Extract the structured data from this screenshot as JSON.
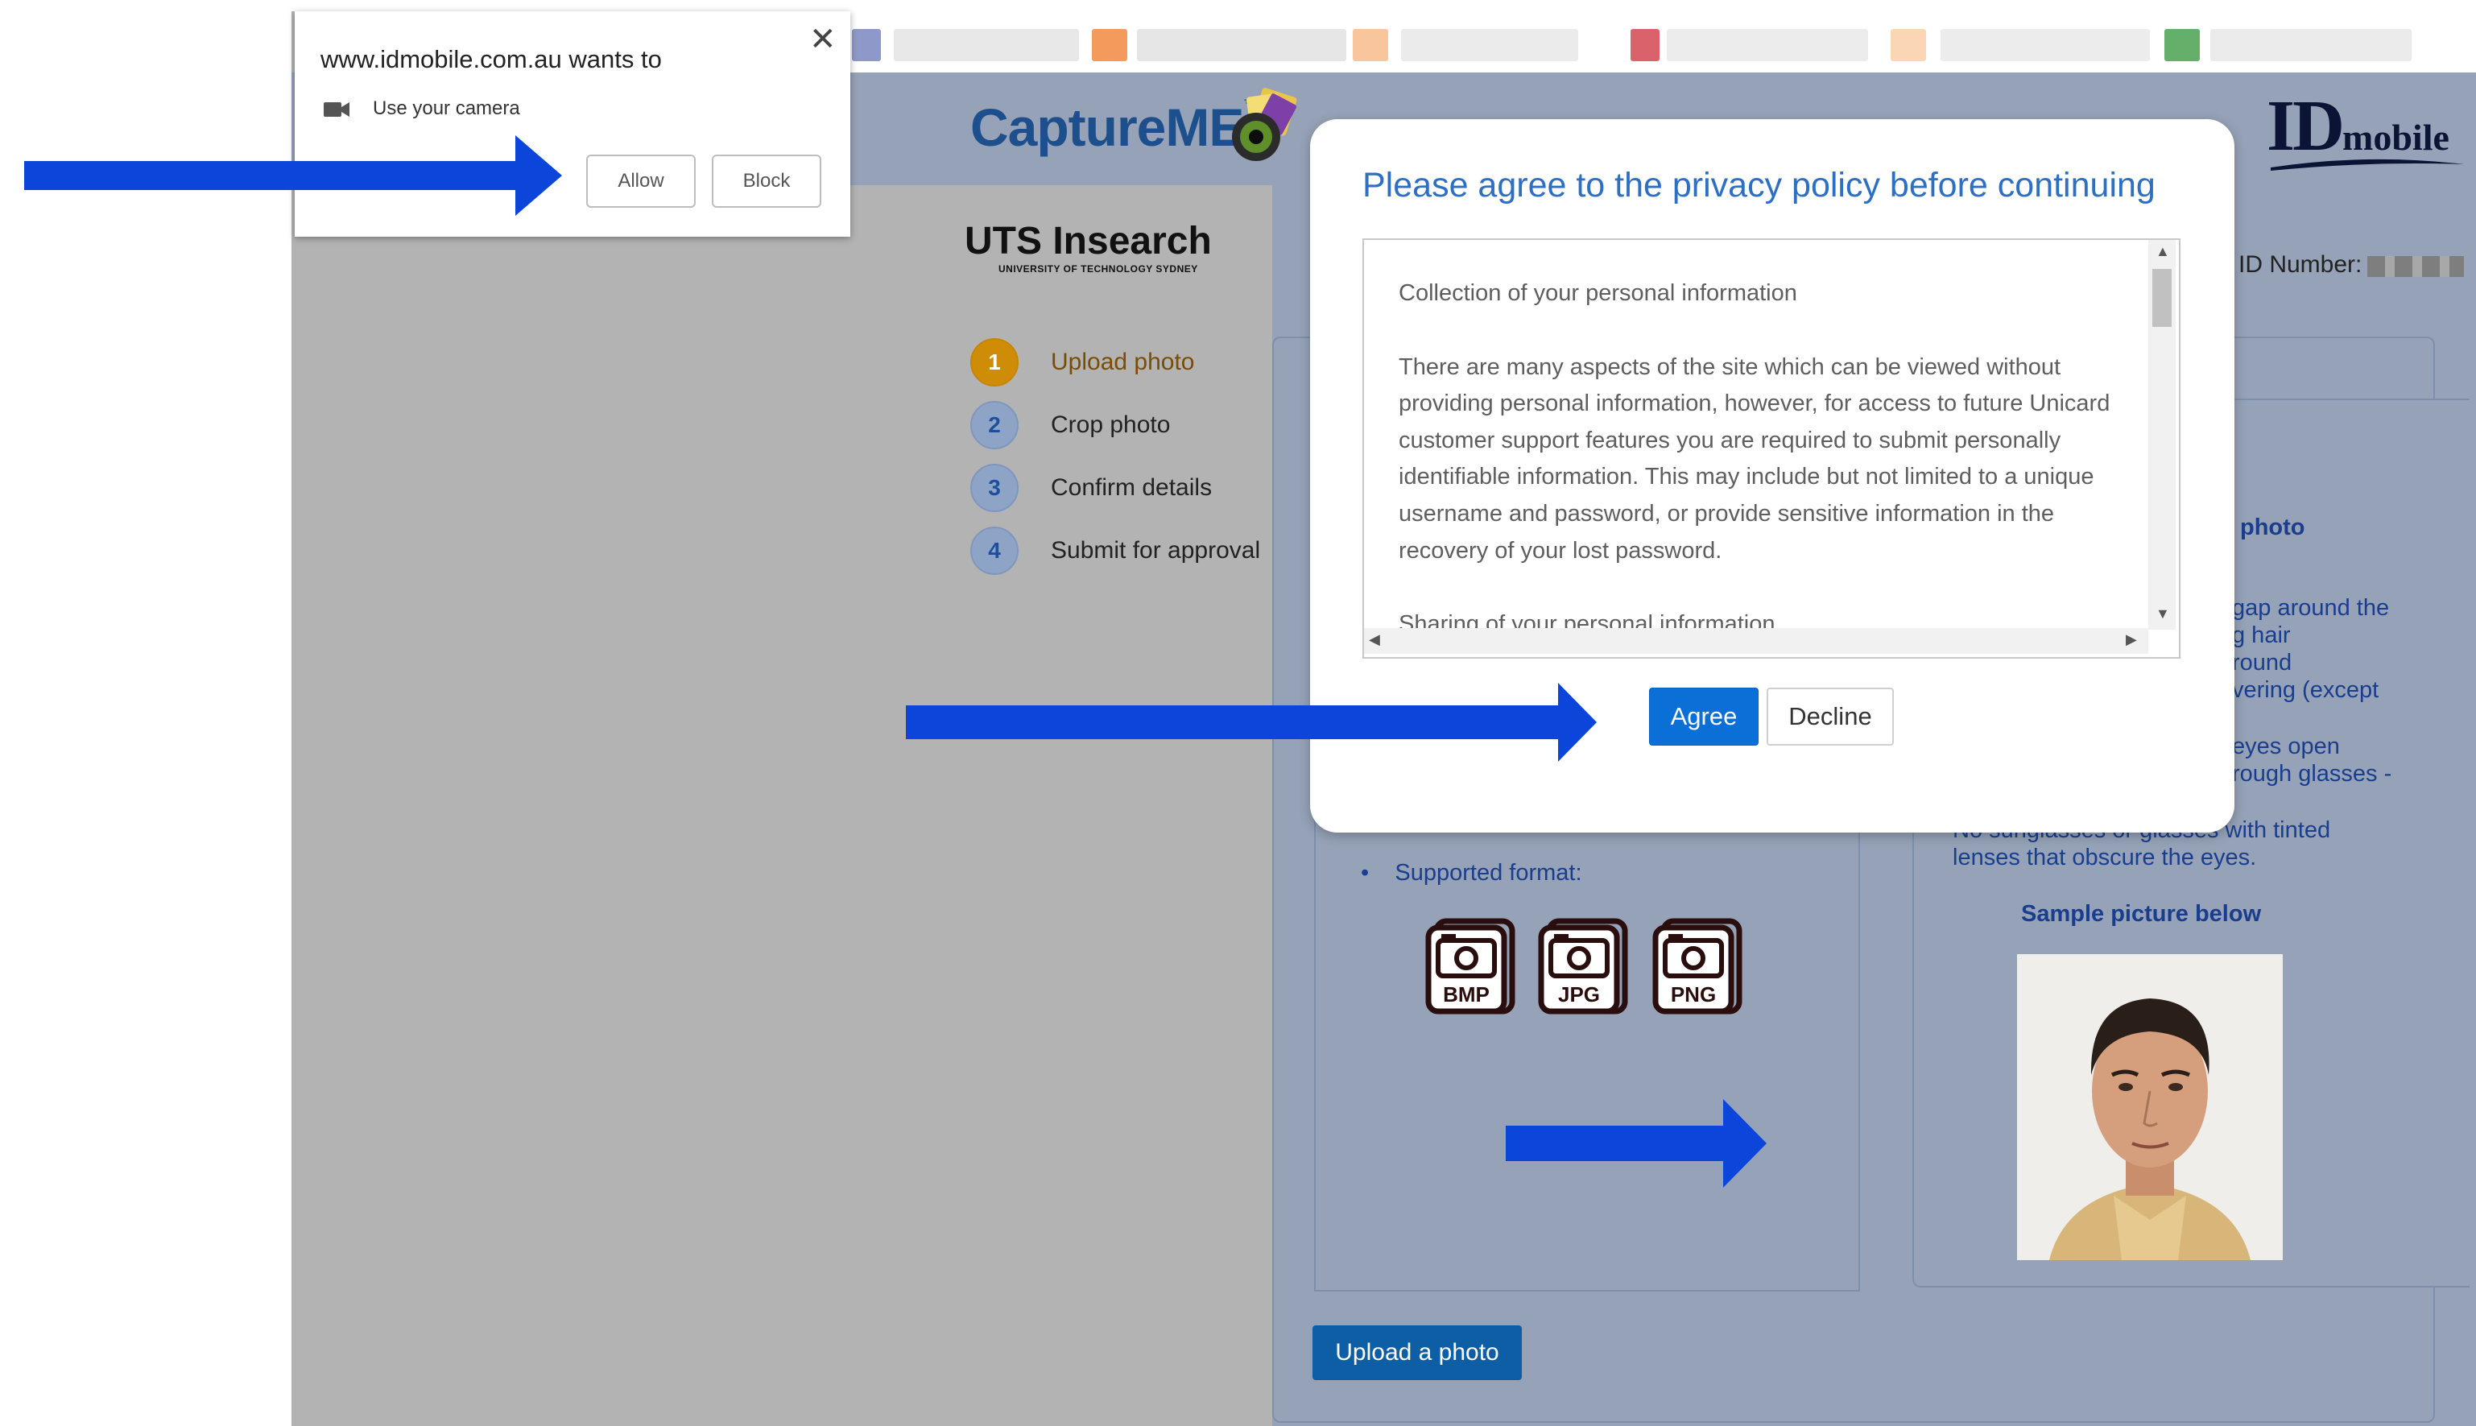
{
  "permission_popup": {
    "title": "www.idmobile.com.au wants to",
    "permission": "Use your camera",
    "allow_label": "Allow",
    "block_label": "Block",
    "close_glyph": "✕",
    "icon": "camera-icon"
  },
  "header": {
    "capture_logo": "CaptureME",
    "capture_tm": "™",
    "idmobile_big": "ID",
    "idmobile_small": "mobile",
    "uts_name": "UTS Insearch",
    "uts_sub": "UNIVERSITY OF TECHNOLOGY SYDNEY"
  },
  "steps": [
    {
      "num": "1",
      "label": "Upload photo",
      "active": true
    },
    {
      "num": "2",
      "label": "Crop photo",
      "active": false
    },
    {
      "num": "3",
      "label": "Confirm details",
      "active": false
    },
    {
      "num": "4",
      "label": "Submit for approval",
      "active": false
    }
  ],
  "id_number_label": "ID Number:",
  "modal": {
    "title": "Please agree to the privacy policy before continuing",
    "paragraphs": [
      "Collection of your personal information",
      "There are many aspects of the site which can be viewed without providing personal information, however, for access to future Unicard customer support features you are required to submit personally identifiable information. This may include but not limited to a unique username and password, or provide sensitive information in the recovery of your lost password.",
      "Sharing of your personal information"
    ],
    "agree_label": "Agree",
    "decline_label": "Decline"
  },
  "right_panel": {
    "title_fragment": "photo",
    "lines": [
      "gap around the",
      "g hair",
      "round",
      "vering (except",
      "eyes open",
      "rough glasses -"
    ],
    "tinted_line1": "No sunglasses or glasses with tinted",
    "tinted_line2": "lenses that obscure the eyes.",
    "sample_title": "Sample picture below"
  },
  "upload": {
    "supported_label": "Supported format:",
    "formats": [
      "BMP",
      "JPG",
      "PNG"
    ],
    "button_label": "Upload a photo"
  },
  "colors": {
    "arrow": "#0b45d9",
    "agree": "#0a6fd6",
    "header_bg": "#95a2b7",
    "step_active": "#cf8d07"
  }
}
